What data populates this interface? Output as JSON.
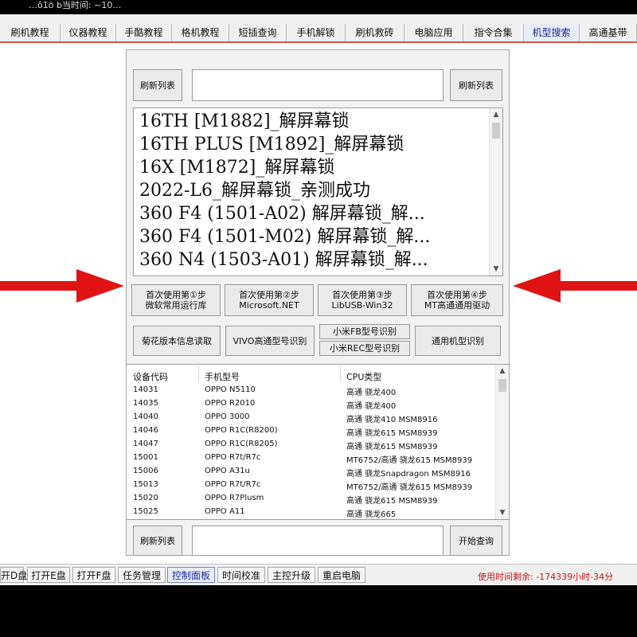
{
  "window": {
    "title": "…ô1ö  b当时间: ~10…"
  },
  "tabs": [
    {
      "label": "刷机教程"
    },
    {
      "label": "仪器教程"
    },
    {
      "label": "手酷教程"
    },
    {
      "label": "格机教程"
    },
    {
      "label": "短插查询"
    },
    {
      "label": "手机解锁"
    },
    {
      "label": "刷机救砖"
    },
    {
      "label": "电脑应用"
    },
    {
      "label": "指令合集"
    },
    {
      "label": "机型搜索",
      "active": true
    },
    {
      "label": "高通基带"
    }
  ],
  "top_row": {
    "left_button": "刷新列表",
    "right_button": "刷新列表",
    "search_value": ""
  },
  "model_list": {
    "items": [
      "16TH [M1882]_解屏幕锁",
      "16TH PLUS [M1892]_解屏幕锁",
      "16X [M1872]_解屏幕锁",
      "2022-L6_解屏幕锁_亲测成功",
      "360 F4 (1501-A02) 解屏幕锁_解...",
      "360 F4 (1501-M02) 解屏幕锁_解...",
      "360 N4 (1503-A01) 解屏幕锁_解..."
    ]
  },
  "step_buttons": [
    {
      "line1": "首次使用第①步",
      "line2": "微软常用运行库"
    },
    {
      "line1": "首次使用第②步",
      "line2": "Microsoft.NET"
    },
    {
      "line1": "首次使用第③步",
      "line2": "LibUSB-Win32"
    },
    {
      "line1": "首次使用第④步",
      "line2": "MT高通通用驱动"
    }
  ],
  "detect_buttons": {
    "huawei": "菊花版本信息读取",
    "vivo": "VIVO高通型号识别",
    "xiaomi_fb": "小米FB型号识别",
    "xiaomi_rec": "小米REC型号识别",
    "generic": "通用机型识别"
  },
  "device_table": {
    "headers": [
      "设备代码",
      "手机型号",
      "CPU类型"
    ],
    "rows": [
      [
        "14031",
        "OPPO N5110",
        "高通 骁龙400"
      ],
      [
        "14035",
        "OPPO R2010",
        "高通 骁龙400"
      ],
      [
        "14040",
        "OPPO 3000",
        "高通 骁龙410 MSM8916"
      ],
      [
        "14046",
        "OPPO R1C(R8200)",
        "高通 骁龙615 MSM8939"
      ],
      [
        "14047",
        "OPPO R1C(R8205)",
        "高通 骁龙615 MSM8939"
      ],
      [
        "15001",
        "OPPO R7t/R7c",
        "MT6752/高通 骁龙615 MSM8939"
      ],
      [
        "15006",
        "OPPO A31u",
        "高通 骁龙Snapdragon MSM8916"
      ],
      [
        "15013",
        "OPPO R7t/R7c",
        "MT6752/高通 骁龙615 MSM8939"
      ],
      [
        "15020",
        "OPPO R7Plusm",
        "高通 骁龙615 MSM8939"
      ],
      [
        "15025",
        "OPPO A11",
        "高通 骁龙665"
      ]
    ]
  },
  "bottom_row": {
    "left_button": "刷新列表",
    "right_button": "开始查询",
    "query_value": ""
  },
  "statusbar": {
    "buttons": [
      {
        "label": "开D盘"
      },
      {
        "label": "打开E盘"
      },
      {
        "label": "打开F盘"
      },
      {
        "label": "任务管理"
      },
      {
        "label": "控制面板",
        "active": true
      },
      {
        "label": "时间校准"
      },
      {
        "label": "主控升级"
      },
      {
        "label": "重启电脑"
      }
    ],
    "time_left": "使用时间剩余: -174339小时-34分"
  },
  "colors": {
    "arrow": "#e01414",
    "accent_red": "#c01818",
    "active_tab": "#1a2a8a"
  },
  "icons": {
    "arrow_left": "red-arrow-right-pointing",
    "arrow_right": "red-arrow-left-pointing",
    "scroll_up": "chevron-up-icon",
    "scroll_down": "chevron-down-icon"
  }
}
